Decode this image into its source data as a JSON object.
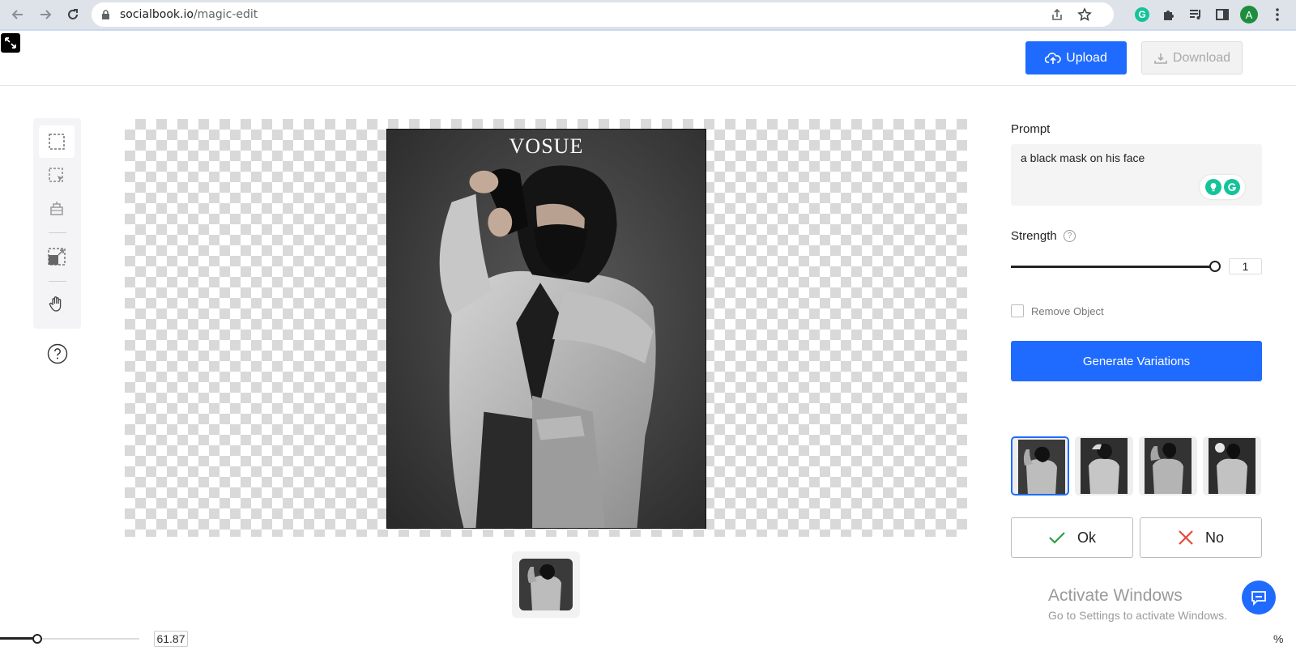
{
  "browser": {
    "url_host": "socialbook.io",
    "url_path": "/magic-edit",
    "profile_initial": "A"
  },
  "header": {
    "upload_label": "Upload",
    "download_label": "Download"
  },
  "canvas": {
    "photo_title": "VOSUE"
  },
  "zoom": {
    "value": "61.87",
    "unit": "%"
  },
  "panel": {
    "prompt_label": "Prompt",
    "prompt_value": "a black mask on his face",
    "strength_label": "Strength",
    "strength_help": "?",
    "strength_value": "1",
    "remove_object_label": "Remove Object",
    "generate_label": "Generate Variations",
    "ok_label": "Ok",
    "no_label": "No"
  },
  "watermark": {
    "title": "Activate Windows",
    "subtitle": "Go to Settings to activate Windows."
  },
  "colors": {
    "accent": "#1f6bff",
    "ok_check": "#2e9e44",
    "no_cross": "#e5483b",
    "grammarly": "#15c39a"
  },
  "icons": [
    "back-icon",
    "forward-icon",
    "reload-icon",
    "lock-icon",
    "share-icon",
    "star-icon",
    "grammarly-icon",
    "puzzle-icon",
    "media-icon",
    "sidebar-icon",
    "menu-dots-icon",
    "expand-icon",
    "cloud-upload-icon",
    "download-icon",
    "rect-select-icon",
    "smart-select-icon",
    "eraser-icon",
    "crop-icon",
    "hand-icon",
    "help-icon",
    "check-icon",
    "close-icon",
    "chat-icon"
  ]
}
